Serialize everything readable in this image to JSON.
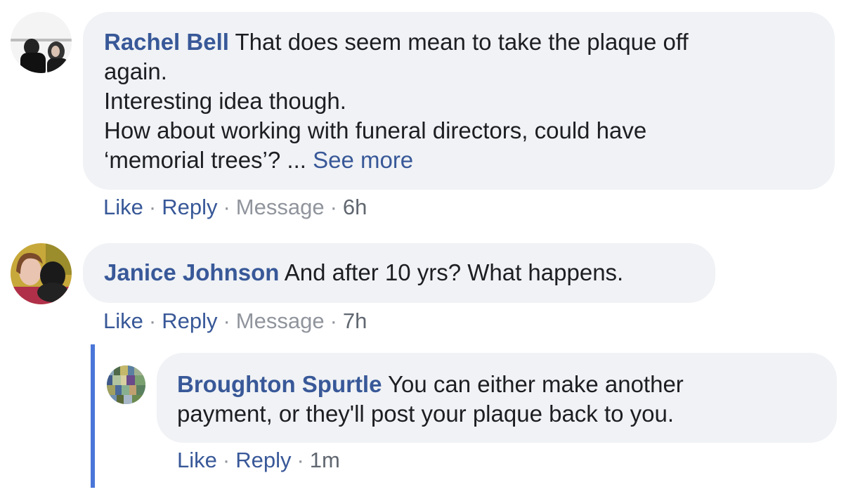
{
  "comments": [
    {
      "author": "Rachel Bell",
      "lines": [
        "That does seem mean to take the plaque off",
        "again.",
        "Interesting idea though.",
        "How about working with funeral directors, could have",
        "‘memorial trees’? ..."
      ],
      "see_more": "See more",
      "actions": {
        "like": "Like",
        "reply": "Reply",
        "message": "Message",
        "time": "6h"
      }
    },
    {
      "author": "Janice Johnson",
      "text": "And after 10 yrs? What happens.",
      "actions": {
        "like": "Like",
        "reply": "Reply",
        "message": "Message",
        "time": "7h"
      }
    }
  ],
  "reply": {
    "author": "Broughton Spurtle",
    "lines": [
      "You can either make another",
      "payment, or they'll post your plaque back to you."
    ],
    "actions": {
      "like": "Like",
      "reply": "Reply",
      "time": "1m"
    }
  },
  "separator": "·",
  "colors": {
    "link": "#385898",
    "bubble": "#f0f2f5",
    "muted": "#90949c",
    "thread_line": "#4a76d9"
  }
}
